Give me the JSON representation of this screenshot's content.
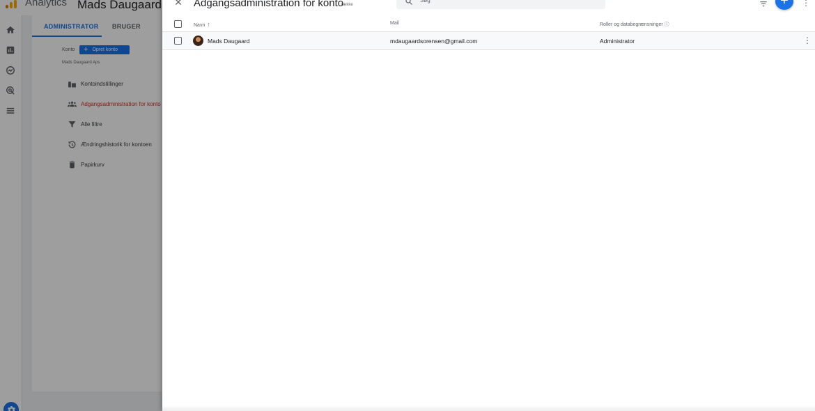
{
  "background": {
    "app_title": "Analytics",
    "account_title": "Mads Daugaard GA",
    "tabs": {
      "admin": "ADMINISTRATOR",
      "user": "BRUGER"
    },
    "konto_label": "Konto",
    "create_account_button": "Opret konto",
    "account_name": "Mads Daugaard Aps",
    "menu": [
      {
        "label": "Kontoindstillinger",
        "icon": "building-icon"
      },
      {
        "label": "Adgangsadministration for konto",
        "icon": "people-icon",
        "active": true
      },
      {
        "label": "Alle filtre",
        "icon": "filter-icon"
      },
      {
        "label": "Ændringshistorik for kontoen",
        "icon": "history-icon"
      },
      {
        "label": "Papirkurv",
        "icon": "trash-icon"
      }
    ]
  },
  "drawer": {
    "title": "Adgangsadministration for konto",
    "row_count": "1 række",
    "search_placeholder": "Søg",
    "columns": {
      "name": "Navn",
      "mail": "Mail",
      "roles": "Roller og databegrænsninger"
    },
    "rows": [
      {
        "name": "Mads Daugaard",
        "mail": "mdaugaardsorensen@gmail.com",
        "role": "Administrator"
      }
    ]
  },
  "colors": {
    "accent": "#1a73e8",
    "active_menu": "#d93025"
  }
}
